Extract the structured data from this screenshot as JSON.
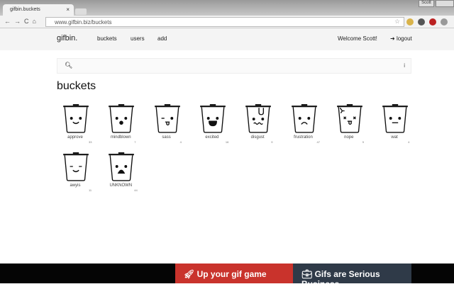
{
  "browser": {
    "tab_title": "gifbin.buckets",
    "url": "www.gifbin.biz/buckets",
    "user": "Scott"
  },
  "nav": {
    "brand": "gifbin.",
    "links": [
      "buckets",
      "users",
      "add"
    ],
    "welcome": "Welcome Scott!",
    "logout": "logout"
  },
  "page": {
    "title": "buckets",
    "info": "i"
  },
  "buckets": [
    {
      "label": "approve",
      "count": "33",
      "face": "smile"
    },
    {
      "label": "mindblown",
      "count": "7",
      "face": "o"
    },
    {
      "label": "sass",
      "count": "4",
      "face": "tongue"
    },
    {
      "label": "excited",
      "count": "16",
      "face": "grin"
    },
    {
      "label": "disgust",
      "count": "9",
      "face": "wavy"
    },
    {
      "label": "frustration",
      "count": "47",
      "face": "frown"
    },
    {
      "label": "nope",
      "count": "9",
      "face": "x"
    },
    {
      "label": "wat",
      "count": "4",
      "face": "flat"
    },
    {
      "label": "awyis",
      "count": "11",
      "face": "smug"
    },
    {
      "label": "UNKNOWN",
      "count": "44",
      "face": "gasp"
    }
  ],
  "footer": {
    "btn1": "Up your gif game",
    "btn2": "Gifs are Serious Business",
    "btn1_color": "#c9332c",
    "btn2_color": "#2f3a48"
  }
}
